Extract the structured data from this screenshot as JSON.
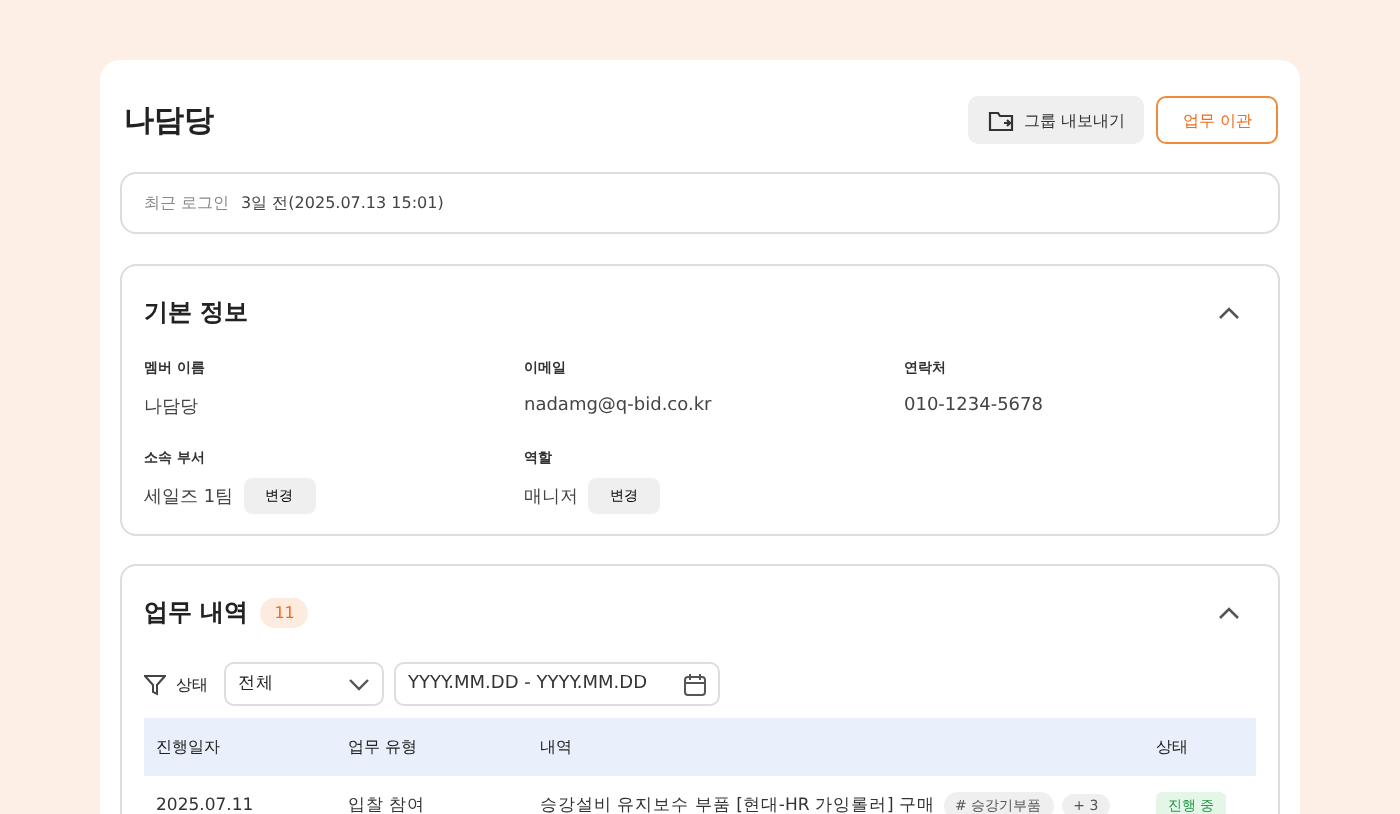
{
  "header": {
    "title": "나담당",
    "buttons": [
      {
        "kind": "export",
        "label": "그룹 내보내기"
      },
      {
        "kind": "transfer",
        "label": "업무 이관"
      }
    ]
  },
  "last_login": {
    "label": "최근 로그인",
    "value": "3일 전(2025.07.13 15:01)"
  },
  "basic_info": {
    "title": "기본 정보",
    "expanded": true,
    "fields": [
      {
        "label": "멤버 이름",
        "value": "나담당"
      },
      {
        "label": "이메일",
        "value": "nadamg@q-bid.co.kr"
      },
      {
        "label": "연락처",
        "value": "010-1234-5678"
      },
      {
        "label": "소속 부서",
        "value": "세일즈 1팀",
        "action": "변경"
      },
      {
        "label": "역할",
        "value": "매니저",
        "action": "변경"
      }
    ]
  },
  "work_history": {
    "title": "업무 내역",
    "count": "11",
    "expanded": true,
    "filter": {
      "label": "상태",
      "select_value": "전체",
      "date_placeholder": "YYYY.MM.DD - YYYY.MM.DD"
    },
    "table": {
      "columns": [
        "진행일자",
        "업무 유형",
        "내역",
        "상태"
      ],
      "rows": [
        {
          "date": "2025.07.11",
          "type": "입찰 참여",
          "detail": "승강설비 유지보수 부품 [현대-HR 가잉롤러] 구매",
          "tags": [
            "# 승강기부품",
            "+ 3"
          ],
          "status": "진행 중"
        }
      ]
    }
  }
}
